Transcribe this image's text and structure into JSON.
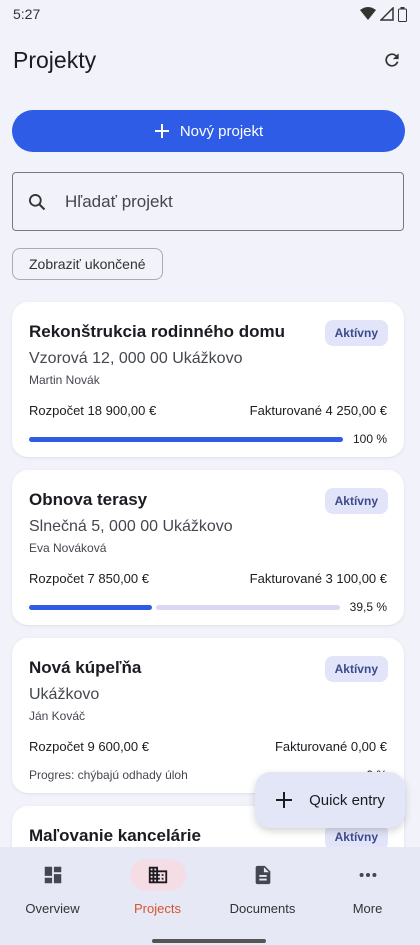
{
  "status_bar": {
    "time": "5:27"
  },
  "header": {
    "title": "Projekty"
  },
  "actions": {
    "new_project_label": "Nový projekt",
    "show_finished_label": "Zobraziť ukončené"
  },
  "search": {
    "placeholder": "Hľadať projekt"
  },
  "projects": [
    {
      "name": "Rekonštrukcia rodinného domu",
      "address": "Vzorová 12, 000 00 Ukážkovo",
      "person": "Martin Novák",
      "status": "Aktívny",
      "budget": "Rozpočet 18 900,00 €",
      "invoiced": "Fakturované 4 250,00 €",
      "progress_pct": "100 %",
      "progress": 1.0
    },
    {
      "name": "Obnova terasy",
      "address": "Slnečná 5, 000 00 Ukážkovo",
      "person": "Eva Nováková",
      "status": "Aktívny",
      "budget": "Rozpočet 7 850,00 €",
      "invoiced": "Fakturované 3 100,00 €",
      "progress_pct": "39,5 %",
      "progress": 0.395
    },
    {
      "name": "Nová kúpeľňa",
      "address": "Ukážkovo",
      "person": "Ján Kováč",
      "status": "Aktívny",
      "budget": "Rozpočet 9 600,00 €",
      "invoiced": "Fakturované 0,00 €",
      "progress_note": "Progres: chýbajú odhady úloh",
      "progress_pct": "0 %"
    },
    {
      "name": "Maľovanie kancelárie",
      "status": "Aktívny"
    }
  ],
  "fab": {
    "label": "Quick entry"
  },
  "nav": {
    "items": [
      {
        "label": "Overview"
      },
      {
        "label": "Projects"
      },
      {
        "label": "Documents"
      },
      {
        "label": "More"
      }
    ]
  },
  "colors": {
    "primary": "#2e5ce6",
    "active_nav": "#d9542c",
    "badge_bg": "#e2e5f9"
  }
}
